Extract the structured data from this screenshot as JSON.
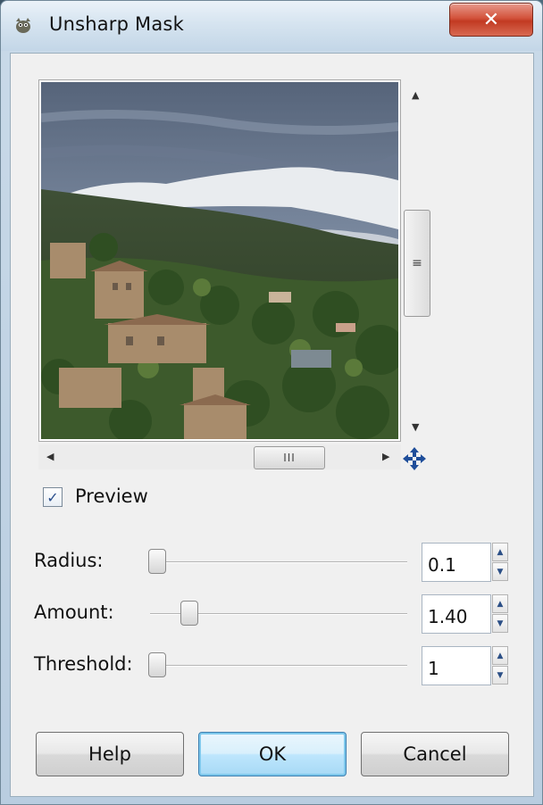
{
  "window": {
    "title": "Unsharp Mask",
    "close_glyph": "✕"
  },
  "preview": {
    "checkbox_label": "Preview",
    "checked": true
  },
  "params": [
    {
      "label": "Radius:",
      "value": "0.1",
      "slider_fraction": 0.02
    },
    {
      "label": "Amount:",
      "value": "1.40",
      "slider_fraction": 0.14
    },
    {
      "label": "Threshold:",
      "value": "1",
      "slider_fraction": 0.02
    }
  ],
  "buttons": {
    "help": "Help",
    "ok": "OK",
    "cancel": "Cancel"
  },
  "icons": {
    "app": "gimp-icon",
    "move": "move-icon",
    "scroll_thumb_v": "≡",
    "scroll_thumb_h": "III"
  },
  "colors": {
    "accent": "#3c7fb1",
    "close": "#c23a22",
    "move_icon": "#1f4e9a"
  }
}
